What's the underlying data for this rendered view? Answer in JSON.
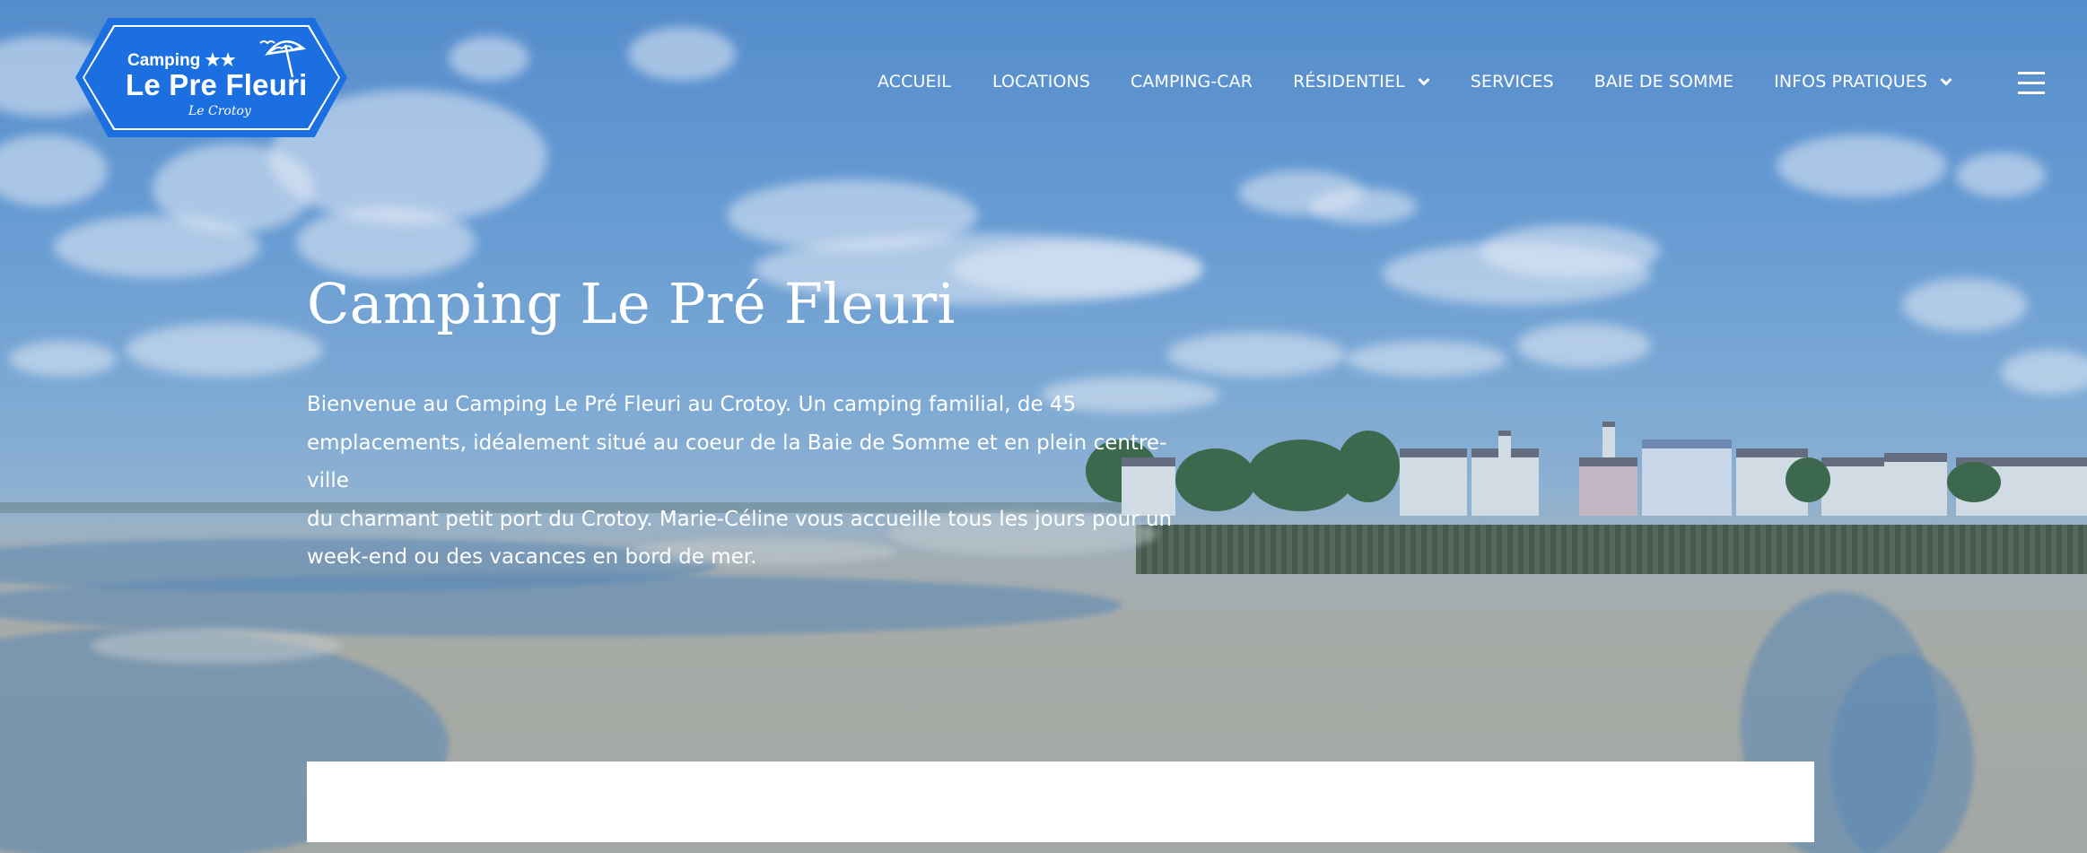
{
  "logo": {
    "line1": "Camping ★★",
    "line2": "Le Pre Fleuri",
    "line3": "Le Crotoy",
    "icon": "beach-umbrella-icon",
    "colors": {
      "fill": "#1b6fe0",
      "stroke": "#ffffff"
    }
  },
  "nav": {
    "items": [
      {
        "label": "ACCUEIL",
        "has_dropdown": false
      },
      {
        "label": "LOCATIONS",
        "has_dropdown": false
      },
      {
        "label": "CAMPING-CAR",
        "has_dropdown": false
      },
      {
        "label": "RÉSIDENTIEL",
        "has_dropdown": true
      },
      {
        "label": "SERVICES",
        "has_dropdown": false
      },
      {
        "label": "BAIE DE SOMME",
        "has_dropdown": false
      },
      {
        "label": "INFOS PRATIQUES",
        "has_dropdown": true
      }
    ],
    "menu_icon": "hamburger-menu-icon"
  },
  "hero": {
    "title": "Camping Le Pré Fleuri",
    "lines": [
      "Bienvenue au Camping Le Pré Fleuri au Crotoy. Un camping familial, de 45",
      "emplacements, idéalement situé au coeur de la Baie de Somme et en plein centre-ville",
      "du charmant petit port du Crotoy. Marie-Céline vous accueille tous les jours pour un",
      "week-end ou des vacances en bord de mer."
    ],
    "background": "seaside-harbour-photo"
  }
}
